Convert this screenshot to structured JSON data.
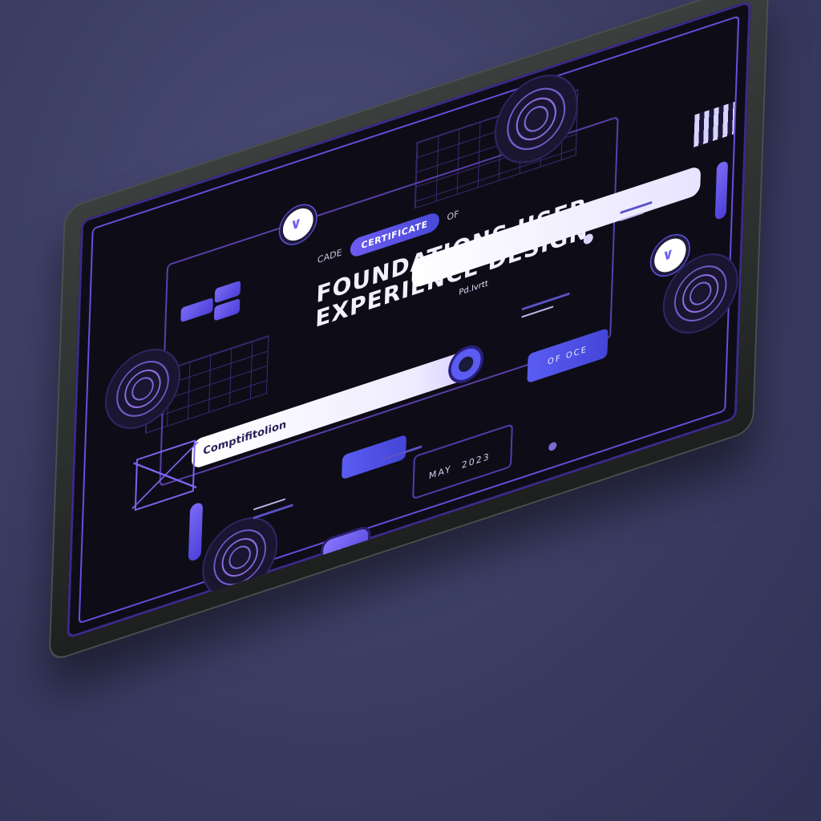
{
  "certificate": {
    "kicker_left": "CADE",
    "pill_label": "CERTIFICATE",
    "kicker_right": "OF",
    "title_line1": "FOUNDATIONS USER",
    "title_line2": "EXPERIENCE DESIGN",
    "completion_label": "Comptifitolion",
    "signature_label": "Pd.Ivrtt"
  },
  "widgets": {
    "button_right_label": "OF OCE",
    "date_label": "MAY",
    "date_value": "2023"
  },
  "colors": {
    "accent": "#6c5cf0",
    "accent_dark": "#4446d8",
    "screen_bg": "#0e0d17",
    "background": "#3a3c62"
  }
}
